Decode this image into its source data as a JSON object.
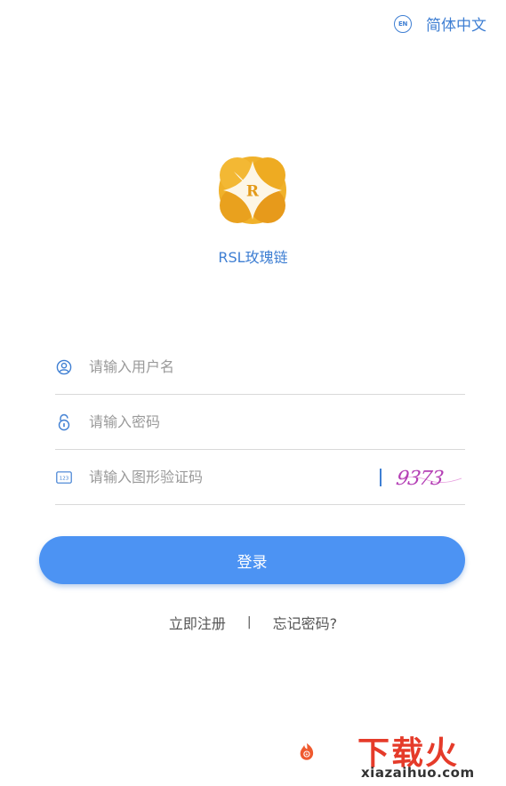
{
  "header": {
    "lang_icon_text": "EN",
    "lang_label": "简体中文"
  },
  "app": {
    "name": "RSL玫瑰链",
    "logo_letter": "R",
    "brand_color": "#e9a020"
  },
  "form": {
    "username_placeholder": "请输入用户名",
    "password_placeholder": "请输入密码",
    "captcha_placeholder": "请输入图形验证码",
    "captcha_icon_text": "123",
    "captcha_text": "9373"
  },
  "actions": {
    "login_label": "登录",
    "register_label": "立即注册",
    "separator": "|",
    "forgot_label": "忘记密码?"
  },
  "watermark": {
    "title": "下载火",
    "domain": "xiazaihuo.com"
  },
  "colors": {
    "accent": "#3f7fd3",
    "button": "#4c93f3"
  }
}
